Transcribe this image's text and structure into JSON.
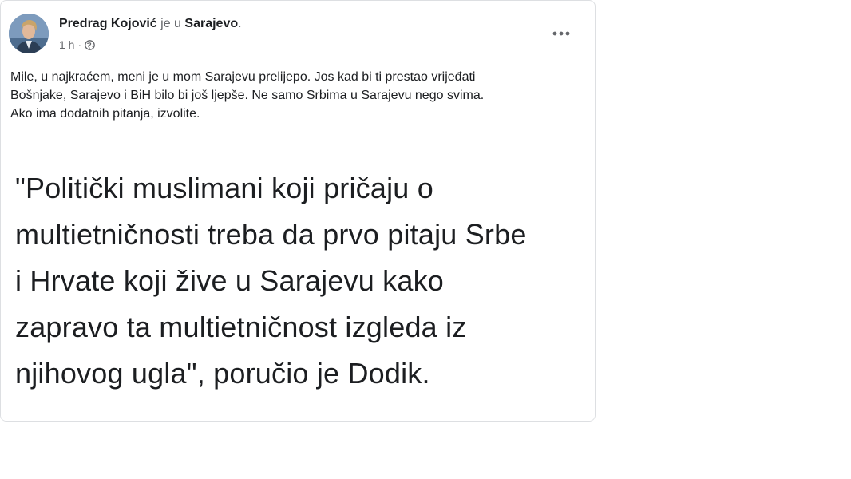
{
  "post": {
    "author": "Predrag Kojović",
    "connector": "je u",
    "place": "Sarajevo",
    "period": ".",
    "time": "1 h",
    "dot": "·",
    "privacy_icon": "globe-icon",
    "more_icon": "more-horizontal-icon",
    "text_lines": [
      "Mile, u najkraćem, meni je u mom Sarajevu prelijepo. Jos kad bi ti prestao vrijeđati",
      "Bošnjake, Sarajevo i BiH bilo bi još ljepše. Ne samo Srbima u Sarajevu nego svima.",
      "Ako ima dodatnih pitanja, izvolite."
    ]
  },
  "quote_image": {
    "lines": [
      "\"Politički muslimani koji pričaju o",
      "multietničnosti treba da prvo pitaju Srbe",
      "i Hrvate koji žive u Sarajevu kako",
      "zapravo ta multietničnost izgleda iz",
      "njihovog ugla\", poručio je Dodik."
    ]
  },
  "colors": {
    "primary_text": "#1c1e21",
    "secondary_text": "#65676b",
    "card_border": "#dddfe2"
  }
}
